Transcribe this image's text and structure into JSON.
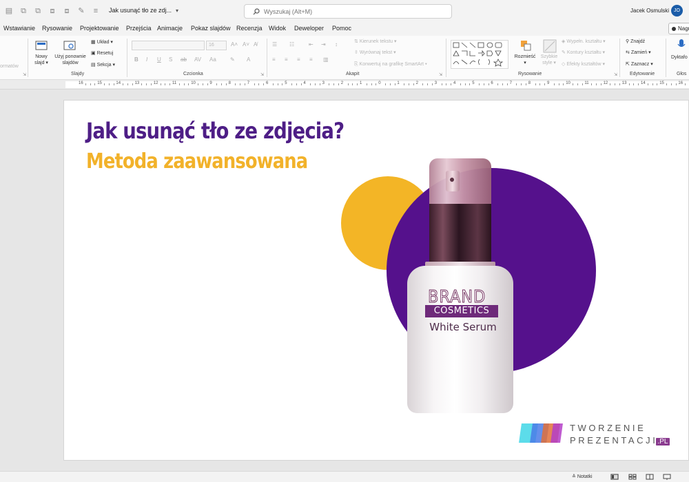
{
  "titlebar": {
    "doc_title": "Jak usunąć tło ze zdj...",
    "doc_title_chevron": "▾",
    "search_placeholder": "Wyszukaj (Alt+M)",
    "user_name": "Jacek Osmulski",
    "user_initials": "JO"
  },
  "tabs": [
    "Wstawianie",
    "Rysowanie",
    "Projektowanie",
    "Przejścia",
    "Animacje",
    "Pokaz slajdów",
    "Recenzja",
    "Widok",
    "Deweloper",
    "Pomoc"
  ],
  "present_label": "Nagr",
  "ribbon": {
    "groups": {
      "slides": "Slajdy",
      "font": "Czcionka",
      "paragraph": "Akapit",
      "drawing": "Rysowanie",
      "editing": "Edytowanie",
      "voice": "Głos"
    },
    "left_fragment": "ormatów",
    "new_slide": [
      "Nowy",
      "slajd ▾"
    ],
    "reuse_slides": [
      "Użyj ponownie",
      "slajdów"
    ],
    "layout": "Układ ▾",
    "reset": "Resetuj",
    "section": "Sekcja ▾",
    "font_size": "16",
    "text_direction": "Kierunek tekstu ▾",
    "align_text": "Wyrównaj tekst ▾",
    "convert_smartart": "Konwertuj na grafikę SmartArt ▾",
    "arrange": [
      "Rozmieść",
      "▾"
    ],
    "quick_styles": [
      "Szybkie",
      "style ▾"
    ],
    "shape_fill": "Wypełn. kształtu ▾",
    "shape_outline": "Kontury kształtu ▾",
    "shape_effects": "Efekty kształtów ▾",
    "find": "Znajdź",
    "replace": "Zamień ▾",
    "select": "Zaznacz ▾",
    "dictate": "Dyktafo"
  },
  "ruler_numbers": [
    "16",
    "15",
    "14",
    "13",
    "12",
    "11",
    "10",
    "9",
    "8",
    "7",
    "6",
    "5",
    "4",
    "3",
    "2",
    "1",
    "0",
    "1",
    "2",
    "3",
    "4",
    "5",
    "6",
    "7",
    "8",
    "9",
    "10",
    "11",
    "12",
    "13",
    "14",
    "15",
    "16"
  ],
  "slide": {
    "title": "Jak usunąć tło ze zdjęcia?",
    "subtitle": "Metoda zaawansowana",
    "bottle_brand": "BRAND",
    "bottle_cosmetics": "COSMETICS",
    "bottle_product": "White Serum",
    "logo_line1": "TWORZENIE",
    "logo_line2": "PREZENTACJI",
    "logo_suffix": ".PL"
  },
  "statusbar": {
    "notes": "Notatki"
  },
  "colors": {
    "title": "#4e1e86",
    "subtitle": "#f2b22a",
    "circle_yellow": "#f3b526",
    "circle_purple": "#55118c",
    "logo_purple": "#8a3b8f"
  },
  "icons": {
    "search": "search-icon",
    "notes": "notes-icon"
  }
}
